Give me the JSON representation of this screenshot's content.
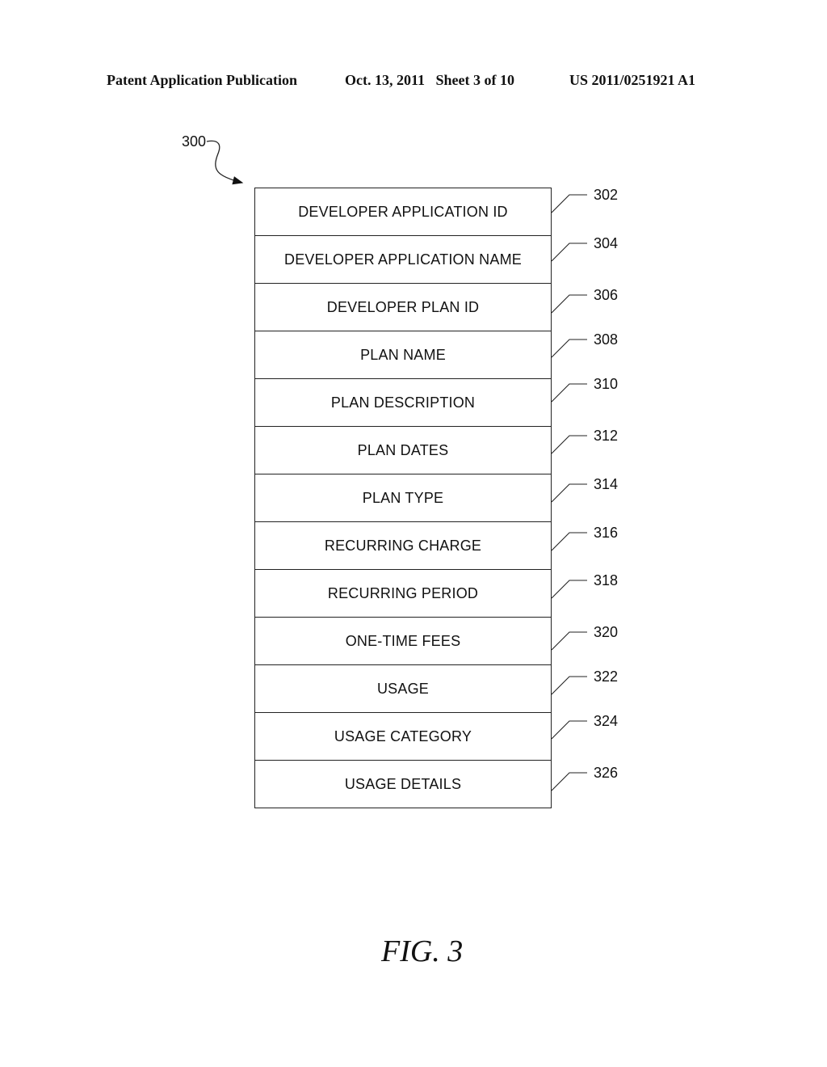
{
  "header": {
    "publication": "Patent Application Publication",
    "date_sheet": "Oct. 13, 2011   Sheet 3 of 10",
    "patent_number": "US 2011/0251921 A1"
  },
  "figure": {
    "reference": "300",
    "caption": "FIG. 3",
    "rows": [
      {
        "label": "DEVELOPER APPLICATION ID",
        "ref": "302"
      },
      {
        "label": "DEVELOPER APPLICATION NAME",
        "ref": "304"
      },
      {
        "label": "DEVELOPER PLAN ID",
        "ref": "306"
      },
      {
        "label": "PLAN NAME",
        "ref": "308"
      },
      {
        "label": "PLAN DESCRIPTION",
        "ref": "310"
      },
      {
        "label": "PLAN DATES",
        "ref": "312"
      },
      {
        "label": "PLAN TYPE",
        "ref": "314"
      },
      {
        "label": "RECURRING CHARGE",
        "ref": "316"
      },
      {
        "label": "RECURRING PERIOD",
        "ref": "318"
      },
      {
        "label": "ONE-TIME FEES",
        "ref": "320"
      },
      {
        "label": "USAGE",
        "ref": "322"
      },
      {
        "label": "USAGE CATEGORY",
        "ref": "324"
      },
      {
        "label": "USAGE DETAILS",
        "ref": "326"
      }
    ]
  }
}
